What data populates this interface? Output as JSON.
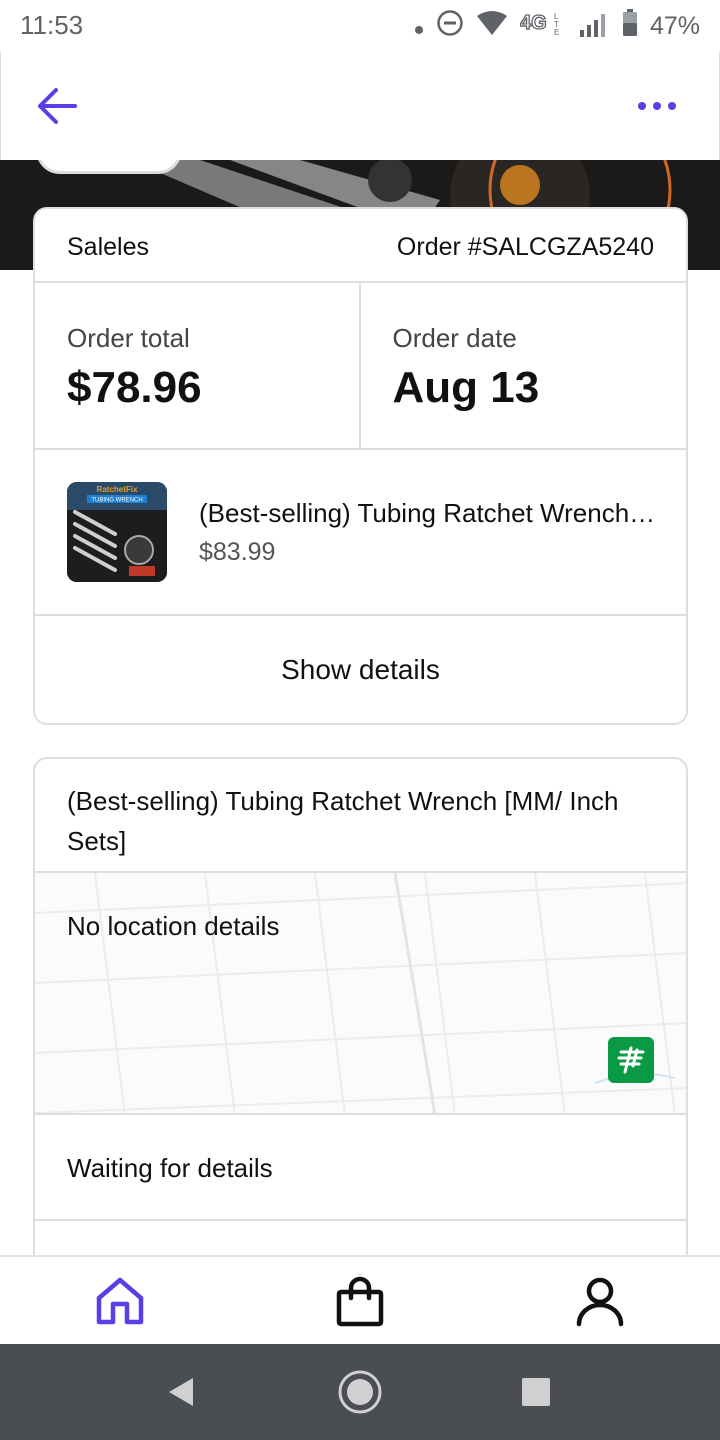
{
  "status_bar": {
    "time": "11:53",
    "network": "4G",
    "battery_percent": "47%",
    "icons": [
      "dot-icon",
      "do-not-disturb-icon",
      "wifi-icon",
      "lte-icon",
      "signal-icon",
      "battery-icon"
    ]
  },
  "app_bar": {
    "back_icon": "arrow-left-icon",
    "more_icon": "more-horizontal-icon",
    "accent_color": "#5a3ee6"
  },
  "order_card": {
    "seller": "Saleles",
    "order_number": "Order #SALCGZA5240",
    "order_total_label": "Order total",
    "order_total_value": "$78.96",
    "order_date_label": "Order date",
    "order_date_value": "Aug 13",
    "item": {
      "title": "(Best-selling) Tubing Ratchet Wrench [MM/ Inch Sets]",
      "price": "$83.99",
      "thumbnail_text": [
        "RatchetFix",
        "TUBING WRENCH"
      ]
    },
    "show_details_label": "Show details"
  },
  "shipment_card": {
    "title": "(Best-selling) Tubing Ratchet Wrench [MM/ Inch Sets]",
    "map_text": "No location details",
    "carrier_icon": "china-post-icon",
    "status_text": "Waiting for details"
  },
  "bottom_nav": {
    "items": [
      {
        "icon": "home-icon",
        "active": true
      },
      {
        "icon": "shopping-bag-icon",
        "active": false
      },
      {
        "icon": "profile-icon",
        "active": false
      }
    ],
    "active_color": "#5a3ee6"
  },
  "system_nav": {
    "icons": [
      "back-triangle-icon",
      "home-circle-icon",
      "recents-square-icon"
    ]
  }
}
